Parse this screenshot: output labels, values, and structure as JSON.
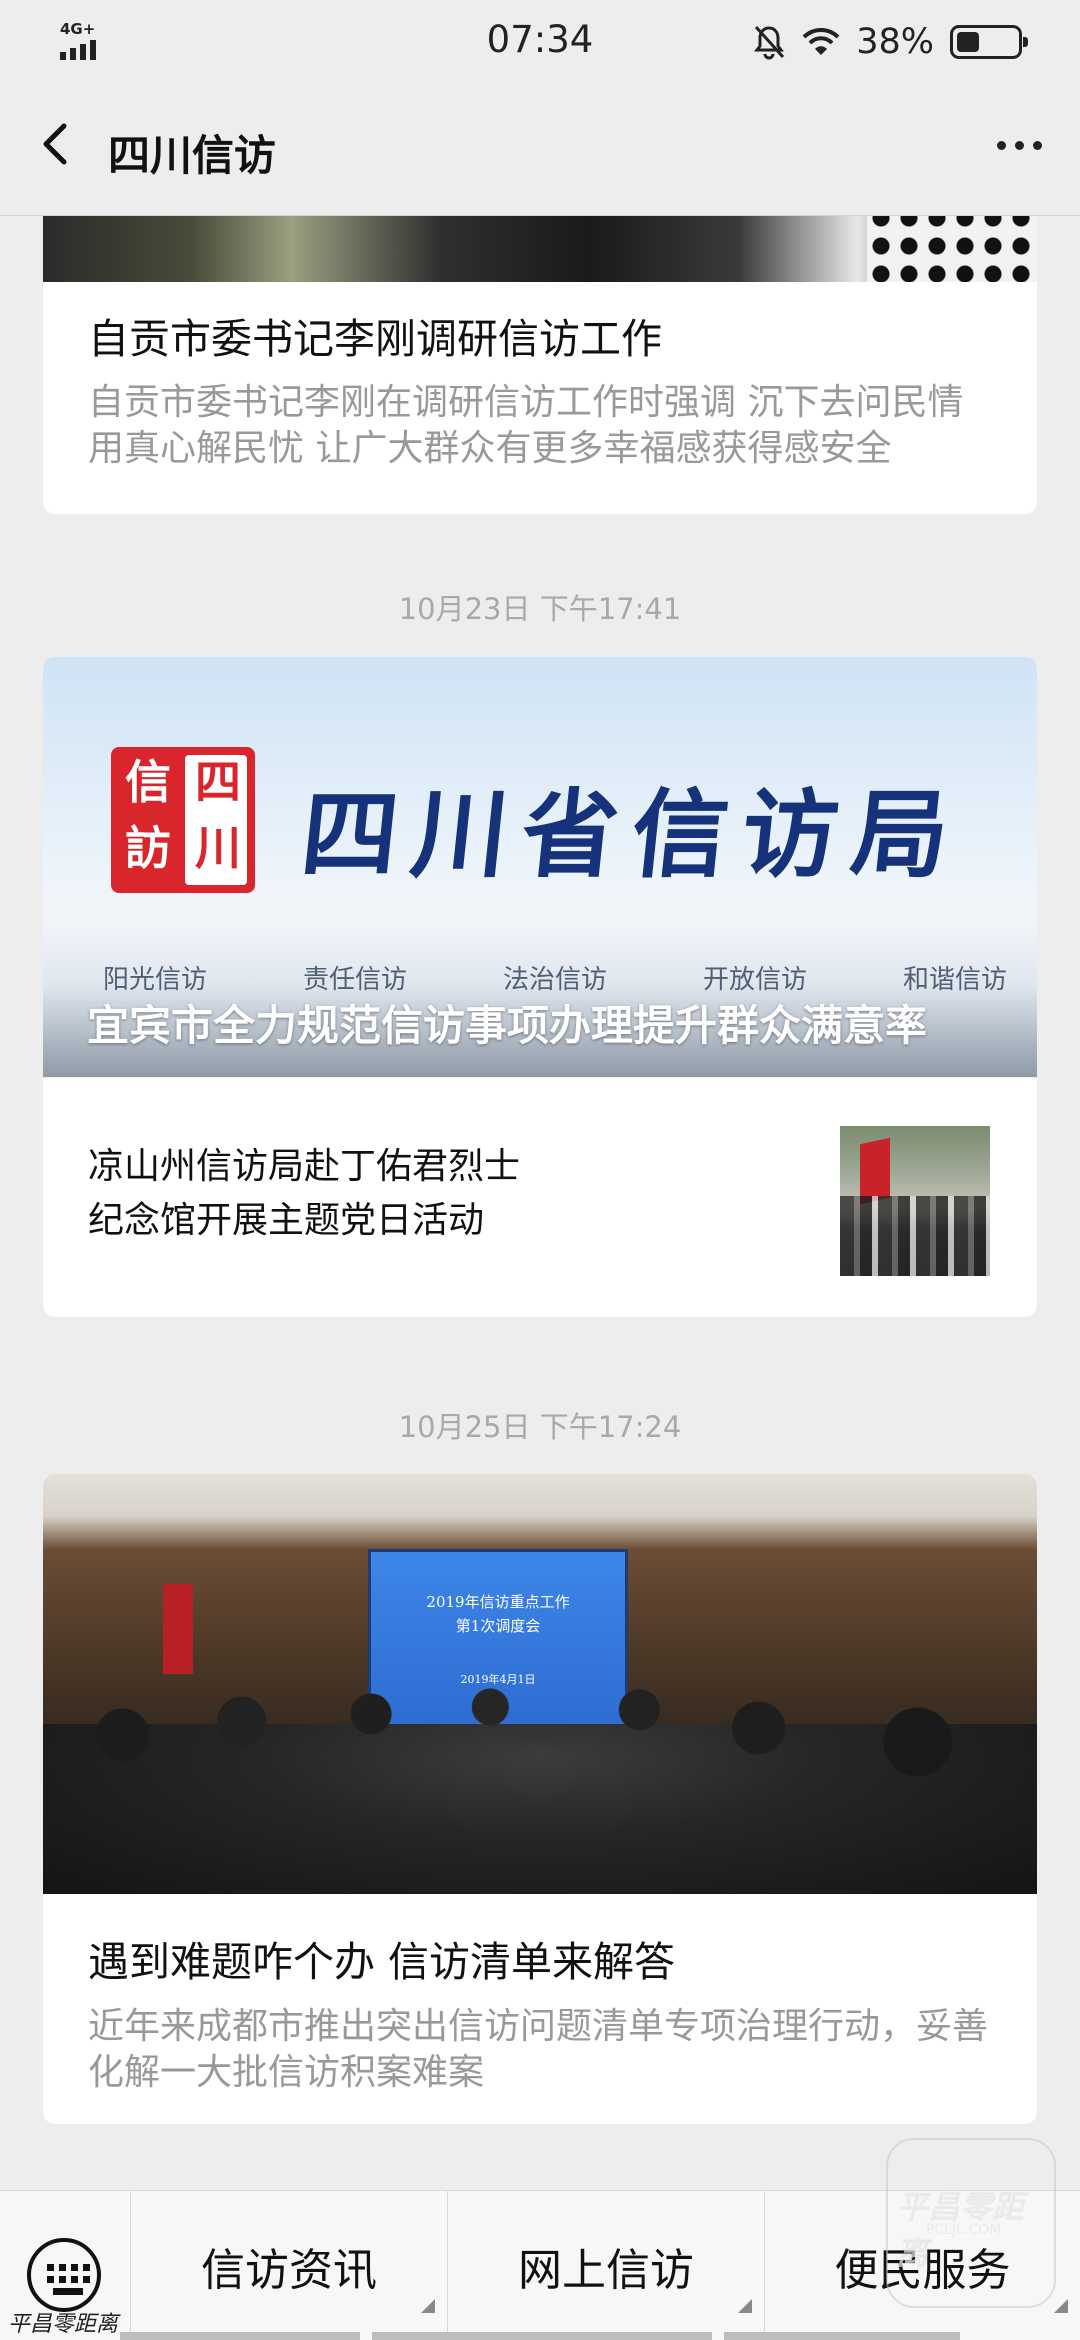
{
  "status_bar": {
    "network": "4G+",
    "time": "07:34",
    "battery": "38%",
    "battery_level": 0.38
  },
  "nav": {
    "title": "四川信访"
  },
  "feed": [
    {
      "title": "自贡市委书记李刚调研信访工作",
      "description": "自贡市委书记李刚在调研信访工作时强调 沉下去问民情 用真心解民忧 让广大群众有更多幸福感获得感安全"
    },
    {
      "time": "10月23日 下午17:41",
      "banner": {
        "seal": [
          "信",
          "訪",
          "四",
          "川"
        ],
        "brand": "四川省信访局",
        "slogans": [
          "阳光信访",
          "责任信访",
          "法治信访",
          "开放信访",
          "和谐信访"
        ],
        "caption": "宜宾市全力规范信访事项办理提升群众满意率"
      },
      "sub_item": {
        "title": "凉山州信访局赴丁佑君烈士纪念馆开展主题党日活动"
      }
    },
    {
      "time": "10月25日 下午17:24",
      "image_screen": {
        "line1": "2019年信访重点工作",
        "line2": "第1次调度会",
        "line3": "2019年4月1日"
      },
      "title": "遇到难题咋个办  信访清单来解答",
      "description": "近年来成都市推出突出信访问题清单专项治理行动，妥善化解一大批信访积案难案"
    }
  ],
  "menu": {
    "items": [
      {
        "label": "信访资讯"
      },
      {
        "label": "网上信访"
      },
      {
        "label": "便民服务"
      }
    ]
  },
  "watermarks": {
    "bottom_left": "平昌零距离",
    "badge_title": "平昌零距离",
    "badge_sub": "PCLJL.COM"
  }
}
